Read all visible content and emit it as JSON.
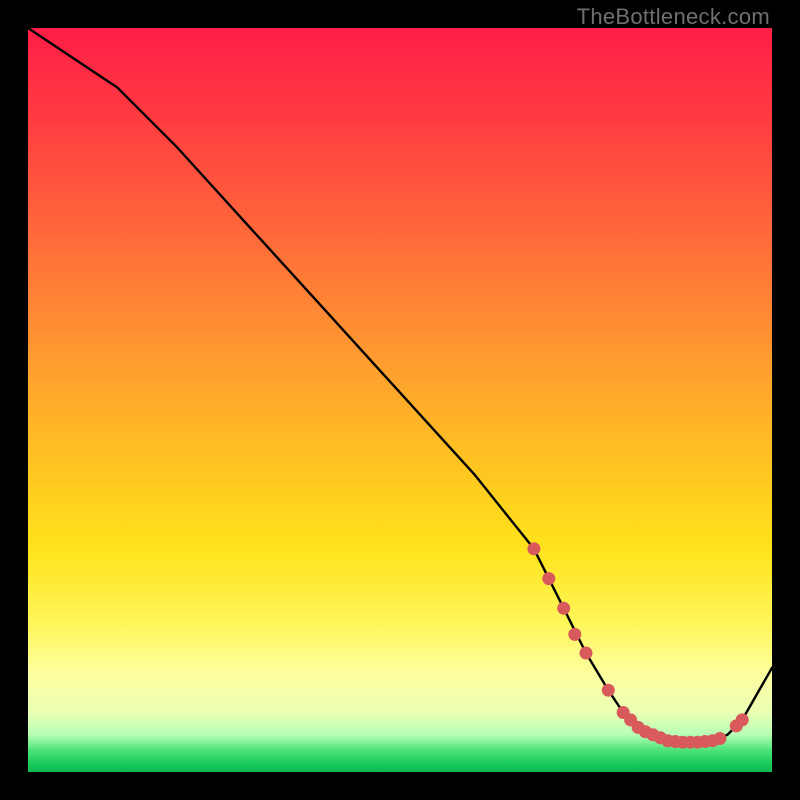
{
  "watermark": "TheBottleneck.com",
  "colors": {
    "background": "#000000",
    "gradient_top": "#ff1e48",
    "gradient_mid": "#ffe31b",
    "gradient_bottom": "#17c95b",
    "line": "#000000",
    "dot": "#d85a5a"
  },
  "chart_data": {
    "type": "line",
    "title": "",
    "xlabel": "",
    "ylabel": "",
    "xlim": [
      0,
      100
    ],
    "ylim": [
      0,
      100
    ],
    "x": [
      0,
      6,
      12,
      20,
      30,
      40,
      50,
      60,
      68,
      72,
      75,
      78,
      80,
      82,
      84,
      86,
      88,
      90,
      92,
      94,
      96,
      100
    ],
    "y": [
      100,
      96,
      92,
      84,
      73,
      62,
      51,
      40,
      30,
      22,
      16,
      11,
      8,
      6,
      5,
      4.2,
      4,
      4,
      4.2,
      5,
      7,
      14
    ],
    "highlight_points": [
      {
        "x": 68,
        "y": 30
      },
      {
        "x": 70,
        "y": 26
      },
      {
        "x": 72,
        "y": 22
      },
      {
        "x": 73.5,
        "y": 18.5
      },
      {
        "x": 75,
        "y": 16
      },
      {
        "x": 78,
        "y": 11
      },
      {
        "x": 80,
        "y": 8
      },
      {
        "x": 81,
        "y": 7
      },
      {
        "x": 82,
        "y": 6
      },
      {
        "x": 83,
        "y": 5.4
      },
      {
        "x": 84,
        "y": 5
      },
      {
        "x": 85,
        "y": 4.6
      },
      {
        "x": 86,
        "y": 4.2
      },
      {
        "x": 87,
        "y": 4.1
      },
      {
        "x": 88,
        "y": 4
      },
      {
        "x": 89,
        "y": 4
      },
      {
        "x": 90,
        "y": 4
      },
      {
        "x": 91,
        "y": 4.1
      },
      {
        "x": 92,
        "y": 4.2
      },
      {
        "x": 93,
        "y": 4.5
      },
      {
        "x": 95.2,
        "y": 6.2
      },
      {
        "x": 96,
        "y": 7
      }
    ],
    "note": "Values are read off the image in percent of the plot area; no axis ticks or labels are visible."
  }
}
